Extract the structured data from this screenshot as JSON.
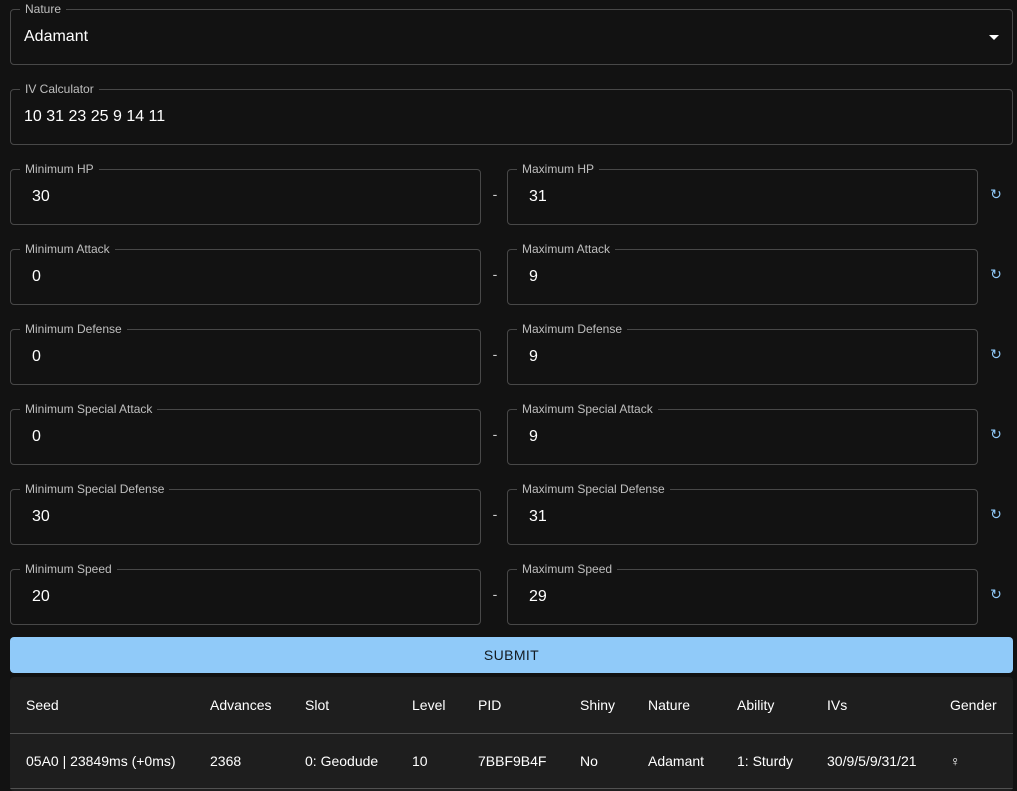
{
  "nature": {
    "label": "Nature",
    "value": "Adamant"
  },
  "iv_calculator": {
    "label": "IV Calculator",
    "value": "10 31 23 25 9 14 11"
  },
  "stats": [
    {
      "min_label": "Minimum HP",
      "min": "30",
      "max_label": "Maximum HP",
      "max": "31"
    },
    {
      "min_label": "Minimum Attack",
      "min": "0",
      "max_label": "Maximum Attack",
      "max": "9"
    },
    {
      "min_label": "Minimum Defense",
      "min": "0",
      "max_label": "Maximum Defense",
      "max": "9"
    },
    {
      "min_label": "Minimum Special Attack",
      "min": "0",
      "max_label": "Maximum Special Attack",
      "max": "9"
    },
    {
      "min_label": "Minimum Special Defense",
      "min": "30",
      "max_label": "Maximum Special Defense",
      "max": "31"
    },
    {
      "min_label": "Minimum Speed",
      "min": "20",
      "max_label": "Maximum Speed",
      "max": "29"
    }
  ],
  "range_separator": "-",
  "reset_icon_glyph": "↻",
  "submit_label": "SUBMIT",
  "results": {
    "headers": [
      "Seed",
      "Advances",
      "Slot",
      "Level",
      "PID",
      "Shiny",
      "Nature",
      "Ability",
      "IVs",
      "Gender"
    ],
    "rows": [
      [
        "05A0 | 23849ms (+0ms)",
        "2368",
        "0: Geodude",
        "10",
        "7BBF9B4F",
        "No",
        "Adamant",
        "1: Sturdy",
        "30/9/5/9/31/21",
        "♀"
      ]
    ]
  },
  "colors": {
    "background": "#121212",
    "accent": "#90caf9",
    "table_bg": "#1e1e1e"
  }
}
